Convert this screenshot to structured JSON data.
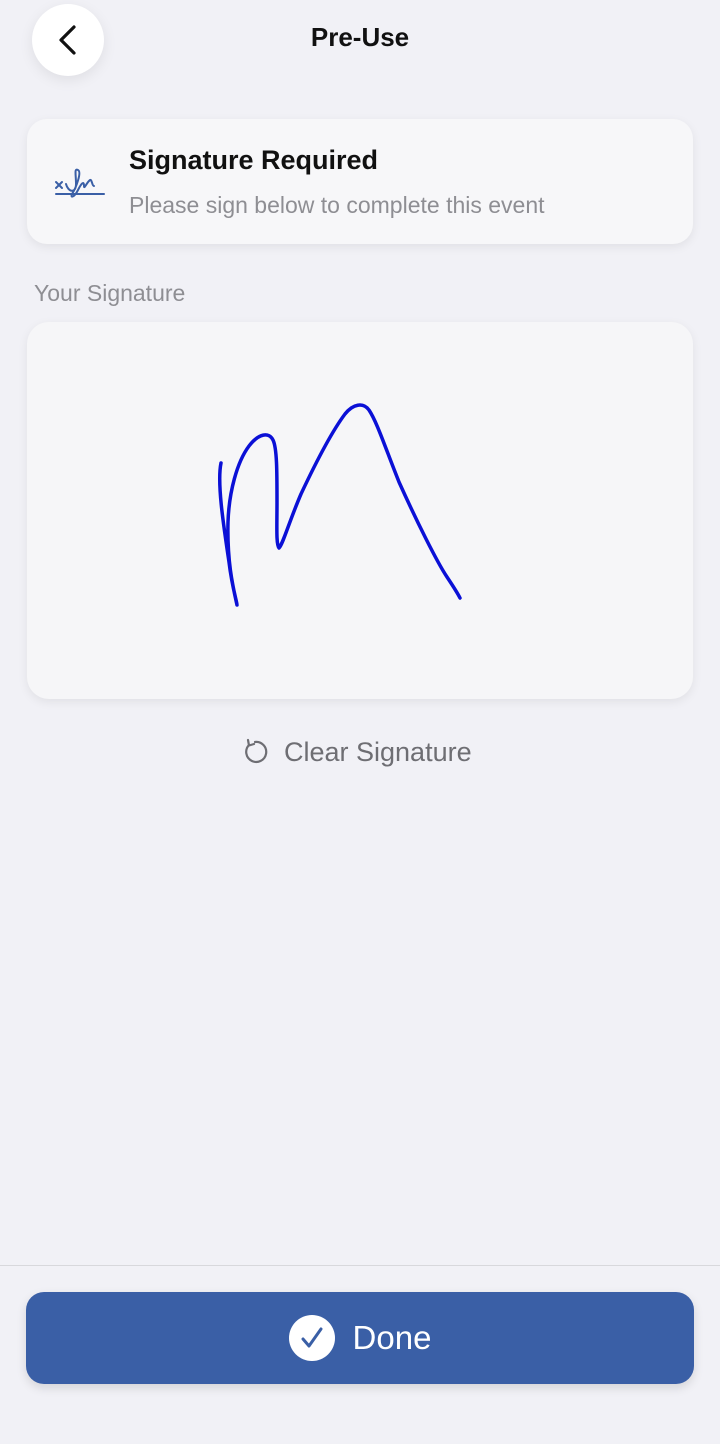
{
  "header": {
    "title": "Pre-Use",
    "back_icon": "chevron-left-icon"
  },
  "info_card": {
    "icon": "signature-icon",
    "title": "Signature Required",
    "subtitle": "Please sign below to complete this event"
  },
  "signature_section": {
    "label": "Your Signature",
    "stroke_color": "#0b10d6"
  },
  "clear_button": {
    "icon": "reset-icon",
    "label": "Clear Signature"
  },
  "done_button": {
    "icon": "checkmark-circle-icon",
    "label": "Done"
  },
  "colors": {
    "accent": "#3a5fa6",
    "background": "#f1f1f6",
    "secondary_text": "#8e8e93"
  }
}
